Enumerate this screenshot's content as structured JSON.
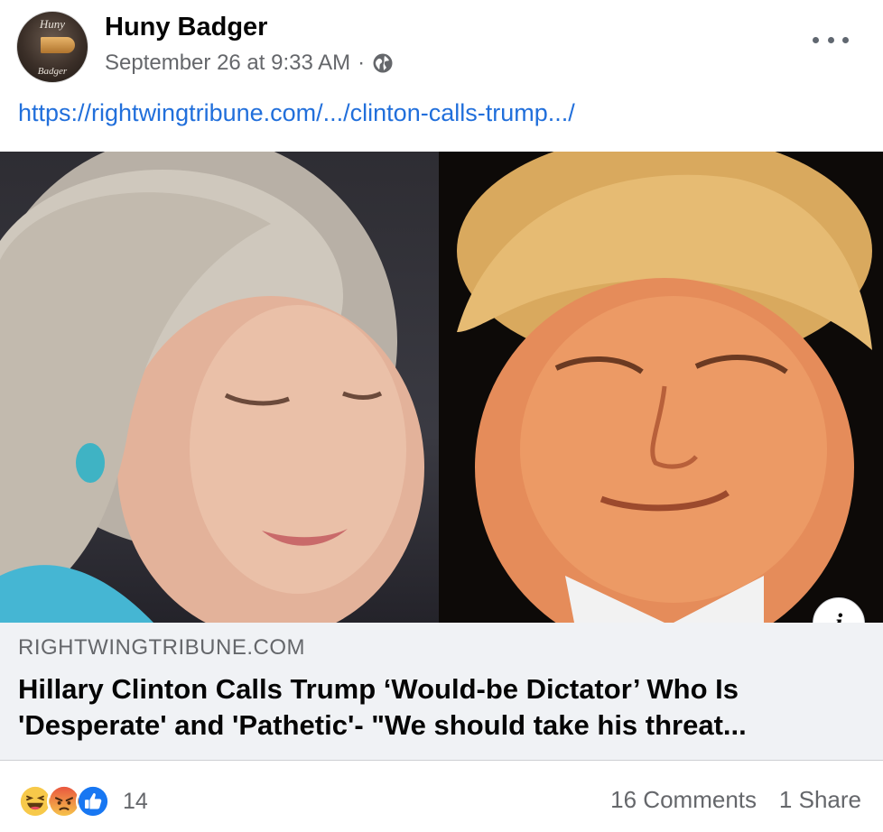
{
  "post": {
    "page_name": "Huny Badger",
    "avatar": {
      "logo_top": "Huny",
      "logo_bottom": "Badger",
      "icon": "bullet-logo"
    },
    "timestamp": "September 26 at 9:33 AM",
    "separator": "·",
    "privacy_icon": "globe-icon",
    "more_icon": "ellipsis-icon",
    "link_url": "https://rightwingtribune.com/.../clinton-calls-trump.../"
  },
  "link_preview": {
    "info_icon": "info-icon",
    "info_label": "i",
    "domain": "RIGHTWINGTRIBUNE.COM",
    "headline": "Hillary Clinton Calls Trump ‘Would-be Dictator’ Who Is 'Desperate' and 'Pathetic'- \"We should take his threat..."
  },
  "footer": {
    "reactions": [
      "haha-reaction-icon",
      "angry-reaction-icon",
      "like-reaction-icon"
    ],
    "reaction_count": "14",
    "comments": "16 Comments",
    "shares": "1 Share"
  },
  "colors": {
    "link": "#216fdb",
    "secondary_text": "#65676b",
    "card_bg": "#f0f2f5",
    "like_blue": "#1877f2",
    "haha_yellow": "#f7c94a",
    "angry_orange": "#e9573f"
  }
}
